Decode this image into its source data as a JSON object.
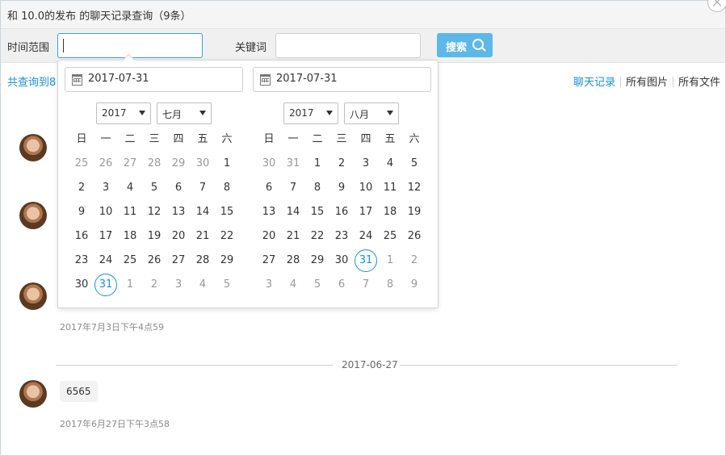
{
  "window": {
    "title": "和 10.0的发布 的聊天记录查询（9条）"
  },
  "search": {
    "time_label": "时间范围",
    "keyword_label": "关键词",
    "button_label": "搜索"
  },
  "results": {
    "count_text": "共查询到8",
    "tabs": [
      {
        "label": "聊天记录",
        "active": true
      },
      {
        "label": "所有图片",
        "active": false
      },
      {
        "label": "所有文件",
        "active": false
      }
    ]
  },
  "messages": [
    {
      "text": "",
      "time": ""
    },
    {
      "text": "",
      "time": ""
    },
    {
      "text": "",
      "time": "2017年7月3日下午4点59"
    },
    {
      "text": "6565",
      "time": "2017年6月27日下午3点58"
    }
  ],
  "date_divider": "2017-06-27",
  "datepicker": {
    "start": {
      "value": "2017-07-31",
      "year": "2017",
      "month": "七月",
      "weekdays": [
        "日",
        "一",
        "二",
        "三",
        "四",
        "五",
        "六"
      ],
      "weeks": [
        [
          "25",
          "26",
          "27",
          "28",
          "29",
          "30",
          "1"
        ],
        [
          "2",
          "3",
          "4",
          "5",
          "6",
          "7",
          "8"
        ],
        [
          "9",
          "10",
          "11",
          "12",
          "13",
          "14",
          "15"
        ],
        [
          "16",
          "17",
          "18",
          "19",
          "20",
          "21",
          "22"
        ],
        [
          "23",
          "24",
          "25",
          "26",
          "27",
          "28",
          "29"
        ],
        [
          "30",
          "31",
          "1",
          "2",
          "3",
          "4",
          "5"
        ]
      ],
      "selected_day": "31"
    },
    "end": {
      "value": "2017-07-31",
      "year": "2017",
      "month": "八月",
      "weekdays": [
        "日",
        "一",
        "二",
        "三",
        "四",
        "五",
        "六"
      ],
      "weeks": [
        [
          "30",
          "31",
          "1",
          "2",
          "3",
          "4",
          "5"
        ],
        [
          "6",
          "7",
          "8",
          "9",
          "10",
          "11",
          "12"
        ],
        [
          "13",
          "14",
          "15",
          "16",
          "17",
          "18",
          "19"
        ],
        [
          "20",
          "21",
          "22",
          "23",
          "24",
          "25",
          "26"
        ],
        [
          "27",
          "28",
          "29",
          "30",
          "31",
          "1",
          "2"
        ],
        [
          "3",
          "4",
          "5",
          "6",
          "7",
          "8",
          "9"
        ]
      ],
      "selected_day": "31"
    }
  },
  "colors": {
    "accent": "#1a90d4",
    "search_button": "#5bb8e8"
  }
}
